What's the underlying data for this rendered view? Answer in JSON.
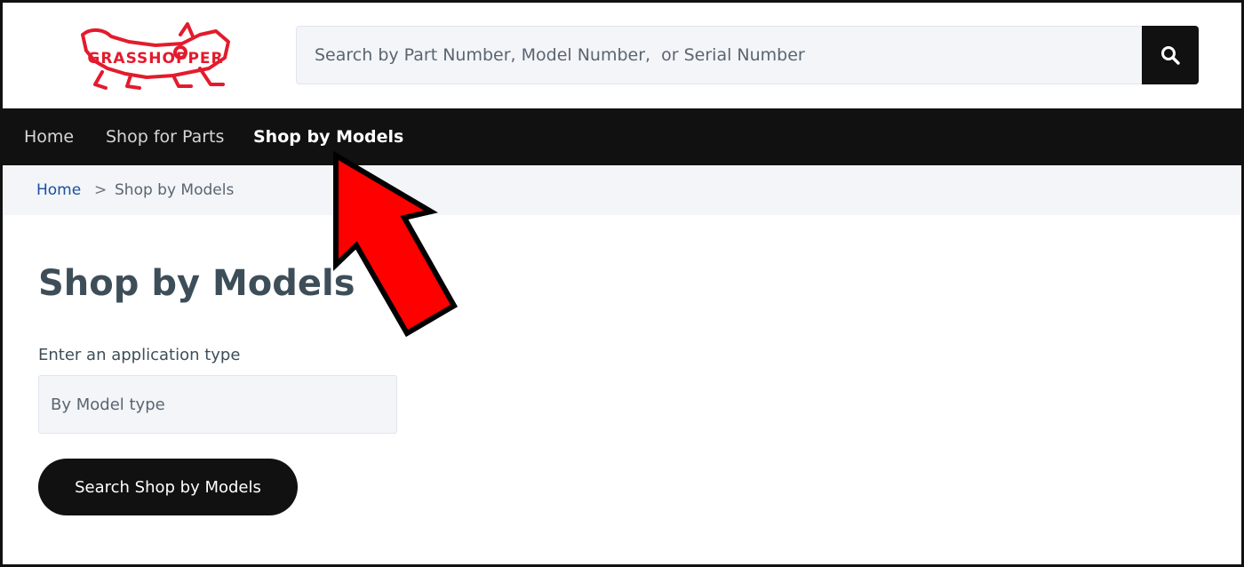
{
  "header": {
    "logo_text": "GRASSHOPPER",
    "search": {
      "placeholder": "Search by Part Number, Model Number,  or Serial Number",
      "value": ""
    }
  },
  "nav": {
    "items": [
      {
        "label": "Home"
      },
      {
        "label": "Shop for Parts"
      },
      {
        "label": "Shop by Models",
        "active": true
      }
    ]
  },
  "breadcrumb": {
    "home": "Home",
    "separator": ">",
    "current": "Shop by Models"
  },
  "main": {
    "title": "Shop by Models",
    "field_label": "Enter an application type",
    "field_placeholder": "By Model type",
    "submit_label": "Search Shop by Models"
  },
  "colors": {
    "nav_bg": "#111111",
    "brand_red": "#e31b2d",
    "link_blue": "#1a4fa0",
    "heading": "#3e4e59",
    "input_bg": "#f3f5f9",
    "arrow_red": "#ff0000"
  },
  "icons": {
    "search": "search-icon",
    "annotation": "red-arrow-icon"
  }
}
